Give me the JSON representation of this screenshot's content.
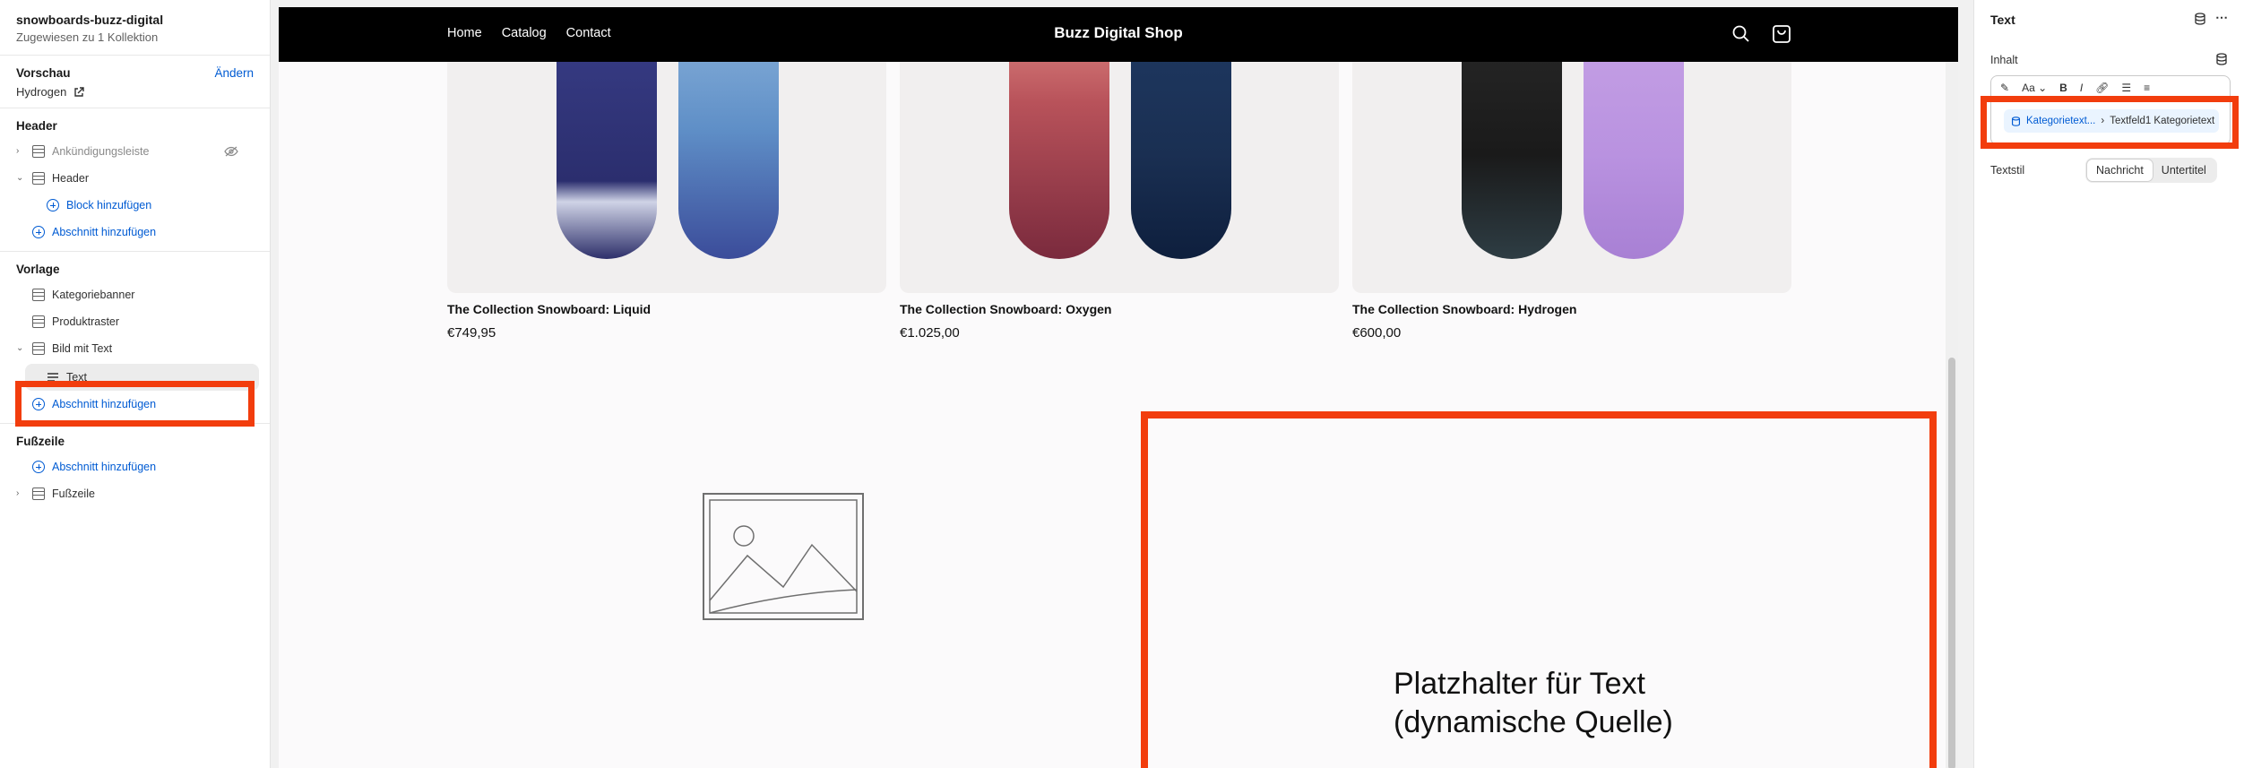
{
  "left_panel": {
    "collection_name": "snowboards-buzz-digital",
    "assigned": "Zugewiesen zu 1 Kollektion",
    "preview_label": "Vorschau",
    "change_link": "Ändern",
    "preview_value": "Hydrogen",
    "sections": {
      "header": {
        "title": "Header",
        "items": [
          "Ankündigungsleiste",
          "Header"
        ],
        "add_block": "Block hinzufügen",
        "add_section": "Abschnitt hinzufügen"
      },
      "template": {
        "title": "Vorlage",
        "items": [
          "Kategoriebanner",
          "Produktraster",
          "Bild mit Text"
        ],
        "selected_child": "Text",
        "add_section": "Abschnitt hinzufügen"
      },
      "footer": {
        "title": "Fußzeile",
        "add_section": "Abschnitt hinzufügen",
        "items": [
          "Fußzeile"
        ]
      }
    }
  },
  "preview": {
    "nav": [
      "Home",
      "Catalog",
      "Contact"
    ],
    "brand": "Buzz Digital Shop",
    "products": [
      {
        "title": "The Collection Snowboard: Liquid",
        "price": "€749,95"
      },
      {
        "title": "The Collection Snowboard: Oxygen",
        "price": "€1.025,00"
      },
      {
        "title": "The Collection Snowboard: Hydrogen",
        "price": "€600,00"
      }
    ],
    "placeholder_line1": "Platzhalter für Text",
    "placeholder_line2": "(dynamische Quelle)"
  },
  "right_panel": {
    "title": "Text",
    "content_label": "Inhalt",
    "source_chip_1": "Kategorietext...",
    "source_chip_2": "Textfeld1 Kategorietext",
    "text_style_label": "Textstil",
    "text_style_options": [
      "Nachricht",
      "Untertitel"
    ]
  },
  "colors": {
    "highlight": "#f23d0d",
    "link": "#005bd3",
    "topbar": "#000000"
  }
}
